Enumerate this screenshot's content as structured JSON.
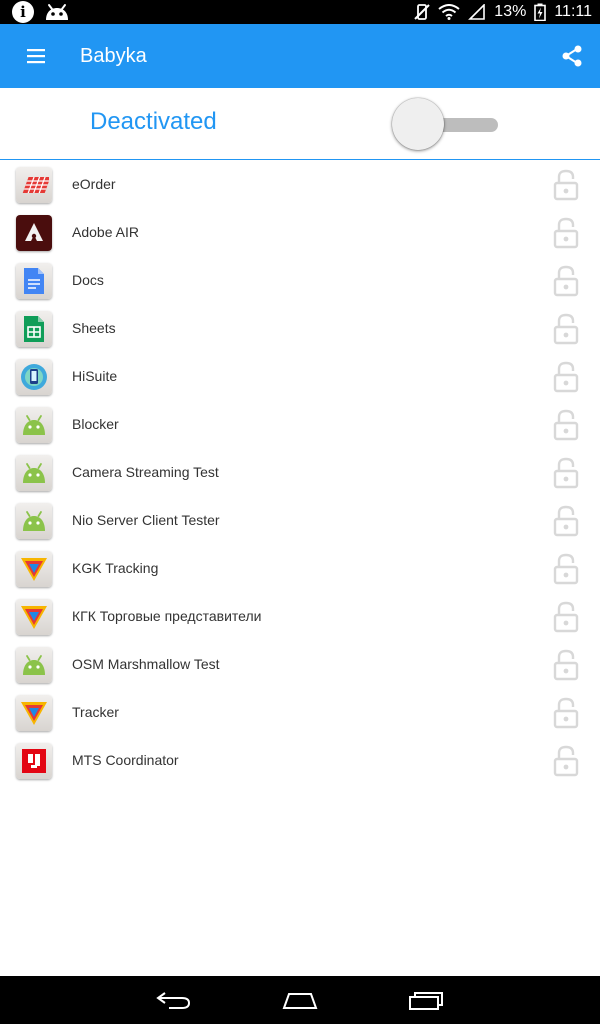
{
  "status_bar": {
    "battery": "13%",
    "time": "11:11"
  },
  "toolbar": {
    "title": "Babyka",
    "menu_icon": "menu-icon",
    "share_icon": "share-icon",
    "color": "#2196f3"
  },
  "activation": {
    "label": "Deactivated",
    "switch_on": false
  },
  "apps": [
    {
      "name": "eOrder",
      "icon": "eorder-icon"
    },
    {
      "name": "Adobe AIR",
      "icon": "adobe-air-icon"
    },
    {
      "name": "Docs",
      "icon": "docs-icon"
    },
    {
      "name": "Sheets",
      "icon": "sheets-icon"
    },
    {
      "name": "HiSuite",
      "icon": "hisuite-icon"
    },
    {
      "name": "Blocker",
      "icon": "android-icon"
    },
    {
      "name": "Camera Streaming Test",
      "icon": "android-icon"
    },
    {
      "name": "Nio Server Client Tester",
      "icon": "android-icon"
    },
    {
      "name": "KGK Tracking",
      "icon": "kgk-icon"
    },
    {
      "name": "КГК Торговые представители",
      "icon": "kgk-icon"
    },
    {
      "name": "OSM Marshmallow Test",
      "icon": "android-icon"
    },
    {
      "name": "Tracker",
      "icon": "kgk-icon"
    },
    {
      "name": "MTS Coordinator",
      "icon": "mts-icon"
    }
  ],
  "lock_icon": "unlocked-lock-icon",
  "nav": {
    "back_icon": "back-icon",
    "home_icon": "home-icon",
    "recents_icon": "recents-icon"
  }
}
